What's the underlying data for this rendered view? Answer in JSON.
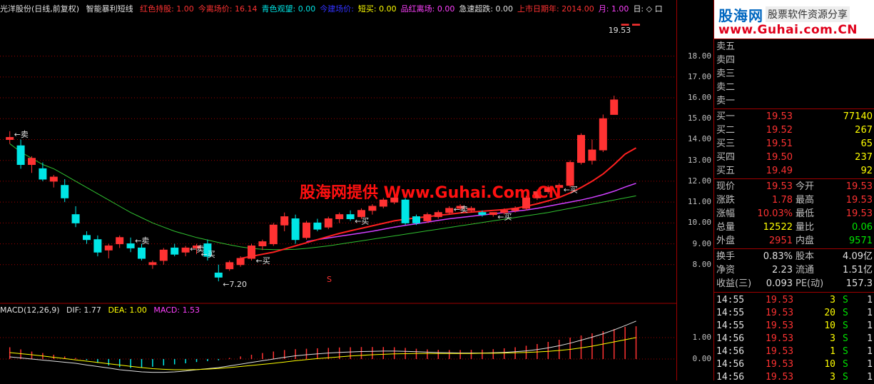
{
  "header": {
    "title": "光洋股份(日线,前复权)",
    "indicator": "智能暴利短线",
    "items": [
      {
        "text": "红色持股: 1.00",
        "color": "#ff3232"
      },
      {
        "text": "今离场价: 16.14",
        "color": "#ff3232"
      },
      {
        "text": "青色观望: 0.00",
        "color": "#00e6e6"
      },
      {
        "text": "今建场价:",
        "color": "#3232ff"
      },
      {
        "text": "短买: 0.00",
        "color": "#ffff00"
      },
      {
        "text": "品红离场: 0.00",
        "color": "#ff40ff"
      },
      {
        "text": "急速超跌: 0.00",
        "color": "#e0e0e0"
      },
      {
        "text": "上市日期年: 2014.00",
        "color": "#ff3232"
      },
      {
        "text": "月: 1.00",
        "color": "#ff40ff"
      },
      {
        "text": "日: ◇ 口",
        "color": "#e0e0e0"
      }
    ]
  },
  "watermark": "股海网提供 Www.Guhai.Com.CN",
  "annotations": {
    "sell": "←卖",
    "buy": "←买",
    "low_label": "←7.20",
    "high_label": "19.53",
    "s_mark": "S"
  },
  "macd": {
    "label": "MACD(12,26,9)",
    "dif": "DIF: 1.77",
    "dea": "DEA: 1.00",
    "macd": "MACD: 1.53",
    "ticks": [
      "1.00",
      "0.00"
    ]
  },
  "price_ticks": [
    "18.00",
    "17.00",
    "16.00",
    "15.00",
    "14.00",
    "13.00",
    "12.00",
    "11.00",
    "10.00",
    "9.00",
    "8.00"
  ],
  "colors": {
    "up": "#ff3232",
    "down": "#00e6e6",
    "ma1": "#ff2020",
    "ma2": "#d040ff",
    "ma3": "#30c030",
    "grid": "#a00000"
  },
  "logo": {
    "site_cn": "股海网",
    "tag": "股票软件资源分享",
    "url": "www.Guhai.com.CN"
  },
  "orderbook": {
    "asks": [
      {
        "label": "卖五",
        "price": "",
        "vol": ""
      },
      {
        "label": "卖四",
        "price": "",
        "vol": ""
      },
      {
        "label": "卖三",
        "price": "",
        "vol": ""
      },
      {
        "label": "卖二",
        "price": "",
        "vol": ""
      },
      {
        "label": "卖一",
        "price": "",
        "vol": ""
      }
    ],
    "bids": [
      {
        "label": "买一",
        "price": "19.53",
        "vol": "77140"
      },
      {
        "label": "买二",
        "price": "19.52",
        "vol": "267"
      },
      {
        "label": "买三",
        "price": "19.51",
        "vol": "65"
      },
      {
        "label": "买四",
        "price": "19.50",
        "vol": "237"
      },
      {
        "label": "买五",
        "price": "19.49",
        "vol": "92"
      }
    ]
  },
  "quote": [
    {
      "l1": "现价",
      "v1": "19.53",
      "c1": "red",
      "l2": "今开",
      "v2": "19.53",
      "c2": "red"
    },
    {
      "l1": "涨跌",
      "v1": "1.78",
      "c1": "red",
      "l2": "最高",
      "v2": "19.53",
      "c2": "red"
    },
    {
      "l1": "涨幅",
      "v1": "10.03%",
      "c1": "red",
      "l2": "最低",
      "v2": "19.53",
      "c2": "red"
    },
    {
      "l1": "总量",
      "v1": "12522",
      "c1": "yel",
      "l2": "量比",
      "v2": "0.06",
      "c2": "grn"
    },
    {
      "l1": "外盘",
      "v1": "2951",
      "c1": "red",
      "l2": "内盘",
      "v2": "9571",
      "c2": "grn"
    }
  ],
  "fundamentals": [
    {
      "l1": "换手",
      "v1": "0.83%",
      "l2": "股本",
      "v2": "4.09亿"
    },
    {
      "l1": "净资",
      "v1": "2.23",
      "l2": "流通",
      "v2": "1.51亿"
    },
    {
      "l1": "收益(三)",
      "v1": "0.093",
      "l2": "PE(动)",
      "v2": "157.3"
    }
  ],
  "trades": [
    {
      "time": "14:55",
      "price": "19.53",
      "qty": "3",
      "side": "S",
      "count": "1"
    },
    {
      "time": "14:55",
      "price": "19.53",
      "qty": "20",
      "side": "S",
      "count": "1"
    },
    {
      "time": "14:55",
      "price": "19.53",
      "qty": "10",
      "side": "S",
      "count": "1"
    },
    {
      "time": "14:56",
      "price": "19.53",
      "qty": "3",
      "side": "S",
      "count": "1"
    },
    {
      "time": "14:56",
      "price": "19.53",
      "qty": "1",
      "side": "S",
      "count": "1"
    },
    {
      "time": "14:56",
      "price": "19.53",
      "qty": "10",
      "side": "S",
      "count": "1"
    },
    {
      "time": "14:56",
      "price": "19.53",
      "qty": "3",
      "side": "S",
      "count": "1"
    }
  ],
  "chart_data": {
    "type": "candlestick",
    "ylim": [
      7.0,
      19.8
    ],
    "candles": [
      [
        14.0,
        14.4,
        13.8,
        14.1
      ],
      [
        13.7,
        14.0,
        12.6,
        12.8
      ],
      [
        12.8,
        13.2,
        12.4,
        13.1
      ],
      [
        12.6,
        12.9,
        12.0,
        12.1
      ],
      [
        12.0,
        12.3,
        11.7,
        12.2
      ],
      [
        11.8,
        12.1,
        11.0,
        11.2
      ],
      [
        10.4,
        10.8,
        9.8,
        10.0
      ],
      [
        9.4,
        9.6,
        9.0,
        9.2
      ],
      [
        9.2,
        9.4,
        8.4,
        8.6
      ],
      [
        8.7,
        9.0,
        8.3,
        8.9
      ],
      [
        9.0,
        9.4,
        8.8,
        9.3
      ],
      [
        9.0,
        9.3,
        8.6,
        8.8
      ],
      [
        8.8,
        9.0,
        8.2,
        8.3
      ],
      [
        8.0,
        8.2,
        7.8,
        8.1
      ],
      [
        8.2,
        8.8,
        8.0,
        8.7
      ],
      [
        8.8,
        9.0,
        8.4,
        8.5
      ],
      [
        8.6,
        8.9,
        8.4,
        8.8
      ],
      [
        8.8,
        9.0,
        8.5,
        8.9
      ],
      [
        9.0,
        9.2,
        8.2,
        8.4
      ],
      [
        7.6,
        8.0,
        7.2,
        7.4
      ],
      [
        7.8,
        8.2,
        7.7,
        8.1
      ],
      [
        8.0,
        8.4,
        7.9,
        8.3
      ],
      [
        8.3,
        9.0,
        8.2,
        8.9
      ],
      [
        8.9,
        9.2,
        8.7,
        9.1
      ],
      [
        9.0,
        10.0,
        8.9,
        9.9
      ],
      [
        9.9,
        10.5,
        9.6,
        10.3
      ],
      [
        10.2,
        10.4,
        9.0,
        9.2
      ],
      [
        9.3,
        10.1,
        9.2,
        10.0
      ],
      [
        10.0,
        10.2,
        9.6,
        9.7
      ],
      [
        9.8,
        10.3,
        9.7,
        10.2
      ],
      [
        10.2,
        10.5,
        10.0,
        10.4
      ],
      [
        10.4,
        10.6,
        10.1,
        10.2
      ],
      [
        10.3,
        10.7,
        10.2,
        10.6
      ],
      [
        10.6,
        10.9,
        10.4,
        10.8
      ],
      [
        10.8,
        11.2,
        10.7,
        11.1
      ],
      [
        11.0,
        11.3,
        10.9,
        11.2
      ],
      [
        11.1,
        11.2,
        9.9,
        10.0
      ],
      [
        10.3,
        10.4,
        9.9,
        10.0
      ],
      [
        10.1,
        10.5,
        10.0,
        10.4
      ],
      [
        10.3,
        10.6,
        10.2,
        10.5
      ],
      [
        10.5,
        10.8,
        10.4,
        10.7
      ],
      [
        10.7,
        10.9,
        10.6,
        10.8
      ],
      [
        10.6,
        10.8,
        10.5,
        10.7
      ],
      [
        10.5,
        10.6,
        10.3,
        10.4
      ],
      [
        10.4,
        10.5,
        10.3,
        10.5
      ],
      [
        10.5,
        10.7,
        10.4,
        10.6
      ],
      [
        10.6,
        10.8,
        10.5,
        10.7
      ],
      [
        10.7,
        11.3,
        10.6,
        11.2
      ],
      [
        11.2,
        11.6,
        11.1,
        11.5
      ],
      [
        11.5,
        11.8,
        11.4,
        11.7
      ],
      [
        11.7,
        11.9,
        11.6,
        11.8
      ],
      [
        11.8,
        13.0,
        11.7,
        12.9
      ],
      [
        12.9,
        14.3,
        12.8,
        14.2
      ],
      [
        13.0,
        14.0,
        12.8,
        13.5
      ],
      [
        13.5,
        15.2,
        13.4,
        15.0
      ],
      [
        15.2,
        16.1,
        15.2,
        15.9
      ],
      [
        19.53,
        19.53,
        19.53,
        19.53
      ],
      [
        19.53,
        19.53,
        19.53,
        19.53
      ]
    ],
    "ma_short": [
      null,
      null,
      null,
      null,
      null,
      null,
      null,
      null,
      null,
      null,
      null,
      null,
      null,
      null,
      null,
      null,
      null,
      null,
      null,
      null,
      null,
      8.3,
      8.4,
      8.5,
      8.6,
      8.75,
      8.9,
      9.05,
      9.2,
      9.35,
      9.5,
      9.62,
      9.74,
      9.86,
      9.98,
      10.1,
      10.18,
      10.24,
      10.3,
      10.36,
      10.42,
      10.48,
      10.52,
      10.56,
      10.6,
      10.64,
      10.7,
      10.8,
      10.92,
      11.06,
      11.22,
      11.44,
      11.7,
      12.0,
      12.35,
      12.8,
      13.3,
      13.6
    ],
    "ma_mid": [
      null,
      null,
      null,
      null,
      null,
      null,
      null,
      null,
      null,
      null,
      null,
      null,
      null,
      null,
      null,
      null,
      null,
      null,
      null,
      null,
      null,
      null,
      null,
      null,
      null,
      null,
      null,
      9.1,
      9.2,
      9.28,
      9.36,
      9.44,
      9.52,
      9.6,
      9.7,
      9.8,
      9.88,
      9.96,
      10.04,
      10.12,
      10.2,
      10.26,
      10.32,
      10.38,
      10.44,
      10.5,
      10.56,
      10.62,
      10.7,
      10.8,
      10.9,
      11.0,
      11.1,
      11.22,
      11.36,
      11.52,
      11.72,
      11.9
    ],
    "ma_long": [
      13.8,
      13.4,
      13.1,
      12.8,
      12.6,
      12.3,
      12.0,
      11.7,
      11.4,
      11.1,
      10.8,
      10.5,
      10.25,
      10.0,
      9.8,
      9.6,
      9.45,
      9.3,
      9.18,
      9.06,
      8.95,
      8.85,
      8.78,
      8.74,
      8.72,
      8.72,
      8.74,
      8.78,
      8.84,
      8.9,
      8.98,
      9.06,
      9.14,
      9.22,
      9.3,
      9.38,
      9.46,
      9.54,
      9.62,
      9.7,
      9.78,
      9.86,
      9.94,
      10.02,
      10.1,
      10.18,
      10.26,
      10.34,
      10.42,
      10.5,
      10.6,
      10.7,
      10.8,
      10.9,
      11.0,
      11.1,
      11.2,
      11.3
    ],
    "macd_hist": [
      0.55,
      0.45,
      0.35,
      0.28,
      0.2,
      0.12,
      0.05,
      -0.05,
      -0.18,
      -0.3,
      -0.38,
      -0.42,
      -0.4,
      -0.36,
      -0.3,
      -0.25,
      -0.2,
      -0.14,
      -0.1,
      -0.06,
      0.05,
      0.12,
      0.2,
      0.28,
      0.35,
      0.42,
      0.46,
      0.48,
      0.5,
      0.52,
      0.54,
      0.55,
      0.56,
      0.56,
      0.56,
      0.55,
      0.52,
      0.48,
      0.45,
      0.43,
      0.42,
      0.42,
      0.43,
      0.44,
      0.46,
      0.5,
      0.55,
      0.62,
      0.7,
      0.8,
      0.9,
      1.0,
      1.1,
      1.2,
      1.3,
      1.4,
      1.5,
      1.53
    ],
    "dif": [
      0.1,
      0.05,
      0.0,
      -0.05,
      -0.1,
      -0.15,
      -0.2,
      -0.28,
      -0.35,
      -0.42,
      -0.5,
      -0.55,
      -0.6,
      -0.62,
      -0.62,
      -0.6,
      -0.56,
      -0.5,
      -0.45,
      -0.4,
      -0.32,
      -0.24,
      -0.16,
      -0.08,
      0.0,
      0.08,
      0.15,
      0.2,
      0.24,
      0.28,
      0.31,
      0.33,
      0.35,
      0.36,
      0.37,
      0.37,
      0.36,
      0.34,
      0.32,
      0.3,
      0.29,
      0.28,
      0.28,
      0.28,
      0.29,
      0.31,
      0.34,
      0.38,
      0.44,
      0.52,
      0.62,
      0.74,
      0.88,
      1.02,
      1.18,
      1.36,
      1.56,
      1.77
    ],
    "dea": [
      0.3,
      0.25,
      0.2,
      0.14,
      0.08,
      0.02,
      -0.04,
      -0.1,
      -0.16,
      -0.22,
      -0.28,
      -0.34,
      -0.4,
      -0.45,
      -0.48,
      -0.5,
      -0.5,
      -0.49,
      -0.47,
      -0.44,
      -0.4,
      -0.35,
      -0.3,
      -0.25,
      -0.2,
      -0.14,
      -0.08,
      -0.03,
      0.02,
      0.06,
      0.1,
      0.14,
      0.17,
      0.2,
      0.22,
      0.24,
      0.25,
      0.26,
      0.26,
      0.26,
      0.26,
      0.26,
      0.26,
      0.27,
      0.27,
      0.28,
      0.29,
      0.31,
      0.33,
      0.36,
      0.4,
      0.45,
      0.52,
      0.6,
      0.7,
      0.8,
      0.9,
      1.0
    ],
    "macd_ylim": [
      -0.9,
      2.1
    ],
    "buy_at": [
      17,
      22,
      31,
      44,
      50
    ],
    "sell_at": [
      0,
      11,
      16,
      40
    ]
  }
}
